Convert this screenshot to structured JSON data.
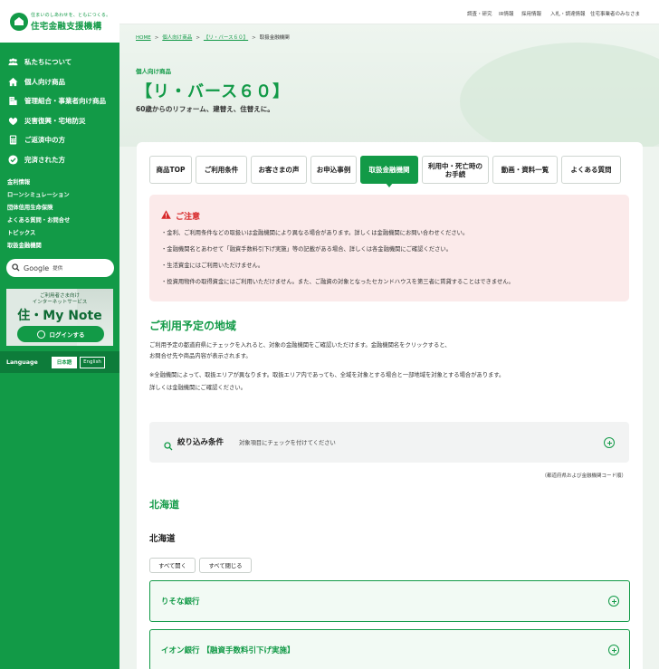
{
  "brand": {
    "tagline": "住まいのしあわせを、ともにつくる。",
    "name": "住宅金融支援機構"
  },
  "sidebar": {
    "primary": [
      {
        "label": "私たちについて",
        "icon": "people-icon"
      },
      {
        "label": "個人向け商品",
        "icon": "house-icon"
      },
      {
        "label": "管理組合・事業者向け商品",
        "icon": "building-icon"
      },
      {
        "label": "災害復興・宅地防災",
        "icon": "hands-icon"
      },
      {
        "label": "ご返済中の方",
        "icon": "calculator-icon"
      },
      {
        "label": "完済された方",
        "icon": "check-circle-icon"
      }
    ],
    "secondary": [
      "金利情報",
      "ローンシミュレーション",
      "団体信用生命保険",
      "よくある質問・お問合せ",
      "トピックス",
      "取扱金融機関"
    ],
    "search": {
      "brand": "Google",
      "label": "提供"
    },
    "banner": {
      "sub_line1": "ご利用者さま向け",
      "sub_line2": "インターネットサービス",
      "title": "住・My Note",
      "button": "ログインする"
    },
    "language": {
      "label": "Language",
      "ja": "日本語",
      "en": "English"
    }
  },
  "topnav": [
    "調査・研究",
    "IR情報",
    "採用情報",
    "入札・調達情報",
    "住宅事業者のみなさま"
  ],
  "breadcrumb": {
    "home": "HOME",
    "level1": "個人向け商品",
    "level2": "【リ・バース６０】",
    "current": "取扱金融機関"
  },
  "hero": {
    "category": "個人向け商品",
    "title": "【リ・バース６０】",
    "lead": "60歳からのリフォーム、建替え、住替えに。"
  },
  "tabs": [
    {
      "label": "商品TOP",
      "active": false
    },
    {
      "label": "ご利用条件",
      "active": false
    },
    {
      "label": "お客さまの声",
      "active": false
    },
    {
      "label": "お申込事例",
      "active": false
    },
    {
      "label": "取扱金融機関",
      "active": true
    },
    {
      "label": "利用中・死亡時の\nお手続",
      "active": false
    },
    {
      "label": "動画・資料一覧",
      "active": false
    },
    {
      "label": "よくある質問",
      "active": false
    }
  ],
  "caution": {
    "title": "ご注意",
    "items": [
      "・金利、ご利用条件などの取扱いは金融機関により異なる場合があります。詳しくは金融機関にお問い合わせください。",
      "・金融機関名とあわせて「融資手数料引下げ実施」等の記載がある場合、詳しくは各金融機関にご確認ください。",
      "・生活資金にはご利用いただけません。",
      "・投資用物件の取得資金にはご利用いただけません。また、ご融資の対象となったセカンドハウスを第三者に賃貸することはできません。"
    ]
  },
  "area": {
    "title": "ご利用予定の地域",
    "desc1": "ご利用予定の都道府県にチェックを入れると、対象の金融機関をご確認いただけます。金融機関名をクリックすると、",
    "desc2": "お問合せ先や商品内容が表示されます。",
    "note1": "※全融機関によって、取扱エリアが異なります。取扱エリア内であっても、全域を対象とする場合と一部地域を対象とする場合があります。",
    "note2": "詳しくは金融機関にご確認ください。"
  },
  "filter": {
    "label": "絞り込み条件",
    "hint": "対象項目にチェックを付けてください"
  },
  "order_note": "（都道府県および金融機関コード順）",
  "region": "北海道",
  "prefecture": "北海道",
  "controls": {
    "open_all": "すべて開く",
    "close_all": "すべて閉じる"
  },
  "banks": [
    "りそな銀行",
    "イオン銀行 【融資手数料引下げ実施】"
  ],
  "colors": {
    "brand_green": "#129a47",
    "caution_red": "#d7292a",
    "caution_bg": "#fbeaea"
  }
}
